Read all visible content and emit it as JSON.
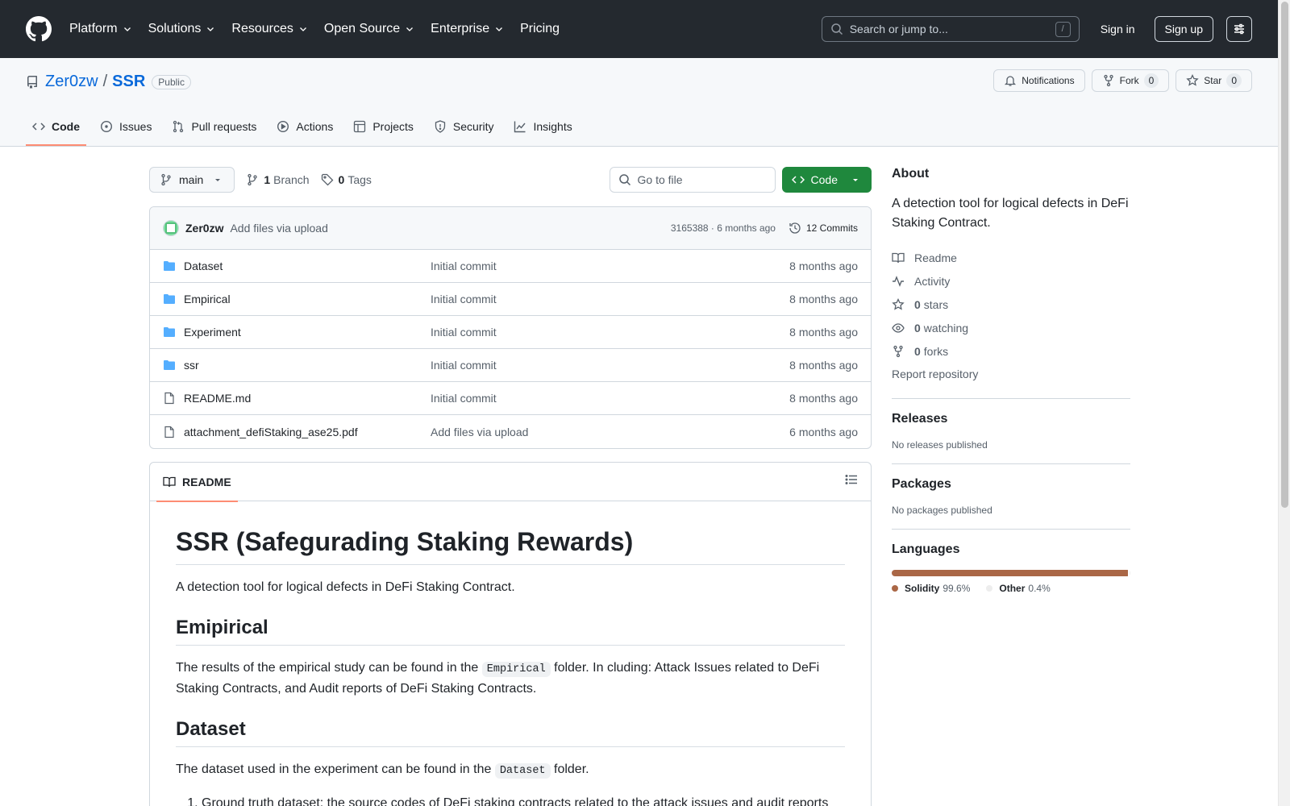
{
  "header": {
    "nav": [
      {
        "label": "Platform",
        "dropdown": true
      },
      {
        "label": "Solutions",
        "dropdown": true
      },
      {
        "label": "Resources",
        "dropdown": true
      },
      {
        "label": "Open Source",
        "dropdown": true
      },
      {
        "label": "Enterprise",
        "dropdown": true
      },
      {
        "label": "Pricing",
        "dropdown": false
      }
    ],
    "search_placeholder": "Search or jump to...",
    "search_kbd": "/",
    "signin": "Sign in",
    "signup": "Sign up"
  },
  "repo": {
    "owner": "Zer0zw",
    "separator": "/",
    "name": "SSR",
    "visibility": "Public",
    "notifications": "Notifications",
    "fork": {
      "label": "Fork",
      "count": "0"
    },
    "star": {
      "label": "Star",
      "count": "0"
    }
  },
  "tabs": [
    {
      "label": "Code",
      "icon": "code-icon",
      "active": true
    },
    {
      "label": "Issues",
      "icon": "issue-icon"
    },
    {
      "label": "Pull requests",
      "icon": "pull-request-icon"
    },
    {
      "label": "Actions",
      "icon": "play-icon"
    },
    {
      "label": "Projects",
      "icon": "table-icon"
    },
    {
      "label": "Security",
      "icon": "shield-icon"
    },
    {
      "label": "Insights",
      "icon": "graph-icon"
    }
  ],
  "toolbar": {
    "branch": "main",
    "branch_count": "1",
    "branch_label": "Branch",
    "tag_count": "0",
    "tag_label": "Tags",
    "goto_placeholder": "Go to file",
    "code_label": "Code"
  },
  "latest_commit": {
    "author": "Zer0zw",
    "message": "Add files via upload",
    "meta": "3165388 · 6 months ago",
    "commits": "12 Commits"
  },
  "files": [
    {
      "name": "Dataset",
      "type": "folder",
      "commit": "Initial commit",
      "age": "8 months ago"
    },
    {
      "name": "Empirical",
      "type": "folder",
      "commit": "Initial commit",
      "age": "8 months ago"
    },
    {
      "name": "Experiment",
      "type": "folder",
      "commit": "Initial commit",
      "age": "8 months ago"
    },
    {
      "name": "ssr",
      "type": "folder",
      "commit": "Initial commit",
      "age": "8 months ago"
    },
    {
      "name": "README.md",
      "type": "file",
      "commit": "Initial commit",
      "age": "8 months ago"
    },
    {
      "name": "attachment_defiStaking_ase25.pdf",
      "type": "file",
      "commit": "Add files via upload",
      "age": "6 months ago"
    }
  ],
  "readme": {
    "tab": "README",
    "h1": "SSR (Safegurading Staking Rewards)",
    "intro": "A detection tool for logical defects in DeFi Staking Contract.",
    "h2_empirical": "Emipirical",
    "empirical_pre": "The results of the empirical study can be found in the ",
    "empirical_code": "Empirical",
    "empirical_post": " folder. In cluding: Attack Issues related to DeFi Staking Contracts, and Audit reports of DeFi Staking Contracts.",
    "h2_dataset": "Dataset",
    "dataset_pre": "The dataset used in the experiment can be found in the ",
    "dataset_code": "Dataset",
    "dataset_post": " folder.",
    "list_item_1": "Ground truth dataset: the source codes of DeFi staking contracts related to the attack issues and audit reports"
  },
  "sidebar": {
    "about_title": "About",
    "description": "A detection tool for logical defects in DeFi Staking Contract.",
    "readme": "Readme",
    "activity": "Activity",
    "stars": {
      "count": "0",
      "label": "stars"
    },
    "watching": {
      "count": "0",
      "label": "watching"
    },
    "forks": {
      "count": "0",
      "label": "forks"
    },
    "report": "Report repository",
    "releases_title": "Releases",
    "releases_empty": "No releases published",
    "packages_title": "Packages",
    "packages_empty": "No packages published",
    "languages_title": "Languages",
    "languages": [
      {
        "name": "Solidity",
        "percent": "99.6%",
        "value": 99.6,
        "color": "#AA6746"
      },
      {
        "name": "Other",
        "percent": "0.4%",
        "value": 0.4,
        "color": "#ededed"
      }
    ]
  }
}
